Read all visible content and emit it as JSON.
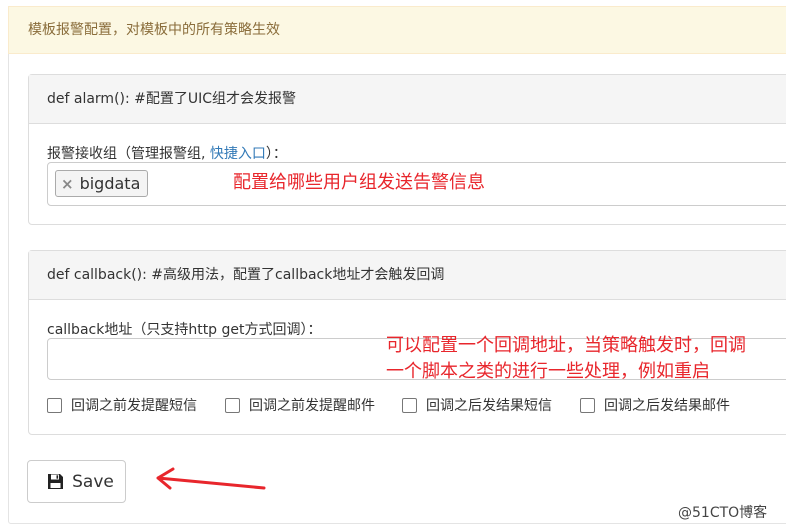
{
  "notice": "模板报警配置，对模板中的所有策略生效",
  "alarm_panel": {
    "heading": "def alarm(): #配置了UIC组才会发报警",
    "label_prefix": "报警接收组（管理报警组, ",
    "label_link": "快捷入口",
    "label_suffix": "）：",
    "tags": [
      "bigdata"
    ]
  },
  "callback_panel": {
    "heading": "def callback(): #高级用法，配置了callback地址才会触发回调",
    "url_label": "callback地址（只支持http get方式回调）：",
    "url_value": "",
    "checkboxes": [
      {
        "label": "回调之前发提醒短信",
        "checked": false
      },
      {
        "label": "回调之前发提醒邮件",
        "checked": false
      },
      {
        "label": "回调之后发结果短信",
        "checked": false
      },
      {
        "label": "回调之后发结果邮件",
        "checked": false
      }
    ]
  },
  "save_button": {
    "label": "Save",
    "icon": "floppy-disk-icon"
  },
  "annotations": {
    "alarm_note": "配置给哪些用户组发送告警信息",
    "callback_note_line1": "可以配置一个回调地址，当策略触发时，回调",
    "callback_note_line2": "一个脚本之类的进行一些处理，例如重启"
  },
  "watermark": "@51CTO博客",
  "colors": {
    "annotation": "#e8262c",
    "link": "#337ab7",
    "notice_bg": "#fcf8e3",
    "notice_text": "#8a6d3b"
  }
}
